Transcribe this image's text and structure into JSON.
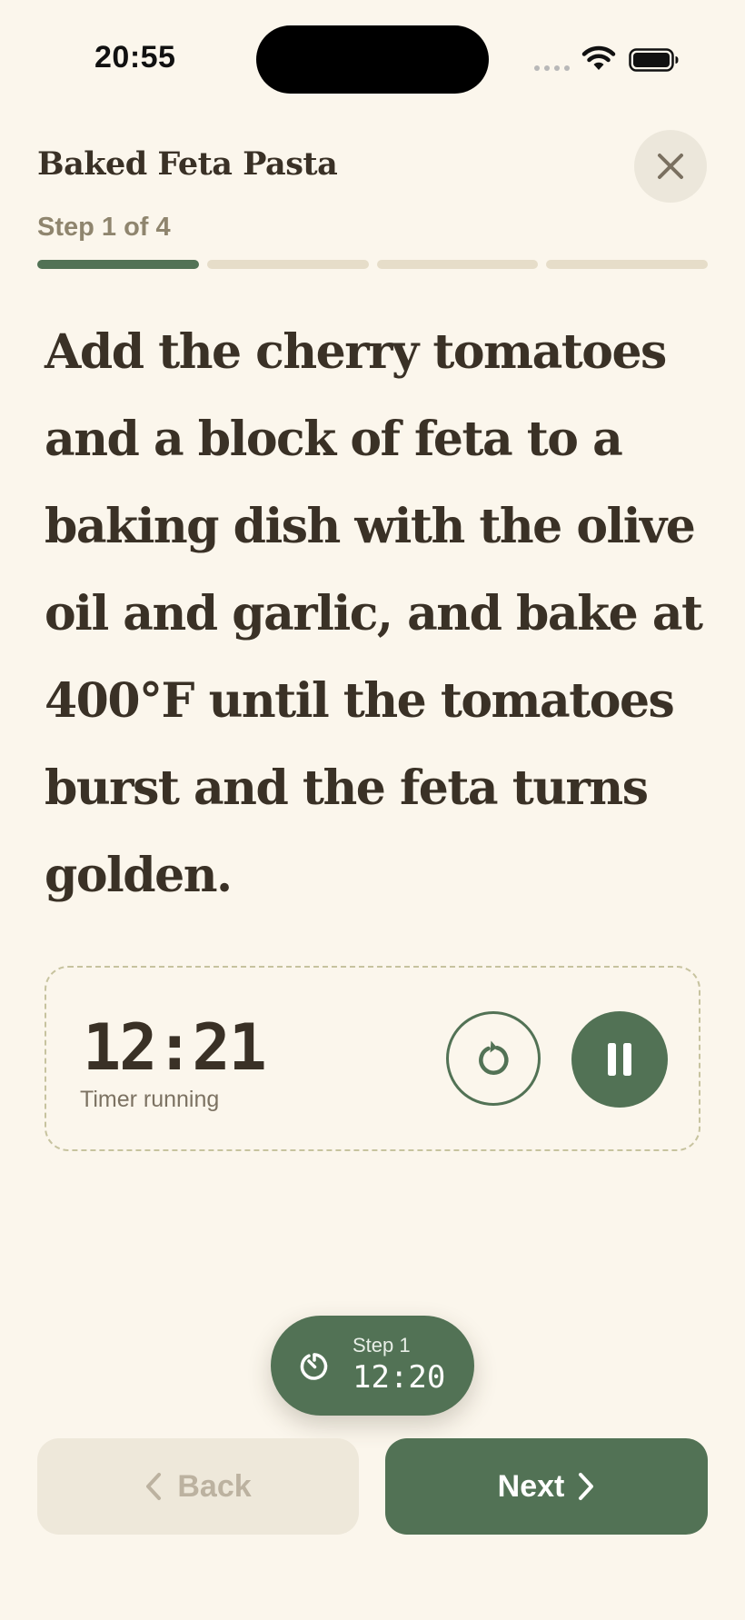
{
  "status_bar": {
    "time": "20:55"
  },
  "header": {
    "title": "Baked Feta Pasta",
    "step_counter": "Step 1 of 4",
    "progress": {
      "total_steps": 4,
      "current_step": 1
    }
  },
  "instruction": {
    "text": "Add the cherry tomatoes and a block of feta to a baking dish with the olive oil and garlic, and bake at 400°F until the tomatoes burst and the feta turns golden."
  },
  "timer_card": {
    "time": "12:21",
    "status": "Timer running"
  },
  "floating_timer": {
    "step_label": "Step 1",
    "time": "12:20"
  },
  "navigation": {
    "back_label": "Back",
    "next_label": "Next"
  },
  "icons": {
    "close": "close-icon",
    "reset": "reset-icon",
    "pause": "pause-icon",
    "timer": "timer-icon",
    "back": "chevron-left-icon",
    "next": "chevron-right-icon",
    "wifi": "wifi-icon",
    "battery": "battery-icon"
  },
  "colors": {
    "background": "#FBF6EC",
    "accent": "#527255",
    "text": "#3A3126",
    "muted": "#8F856E",
    "progress_inactive": "#E6DDC9"
  }
}
